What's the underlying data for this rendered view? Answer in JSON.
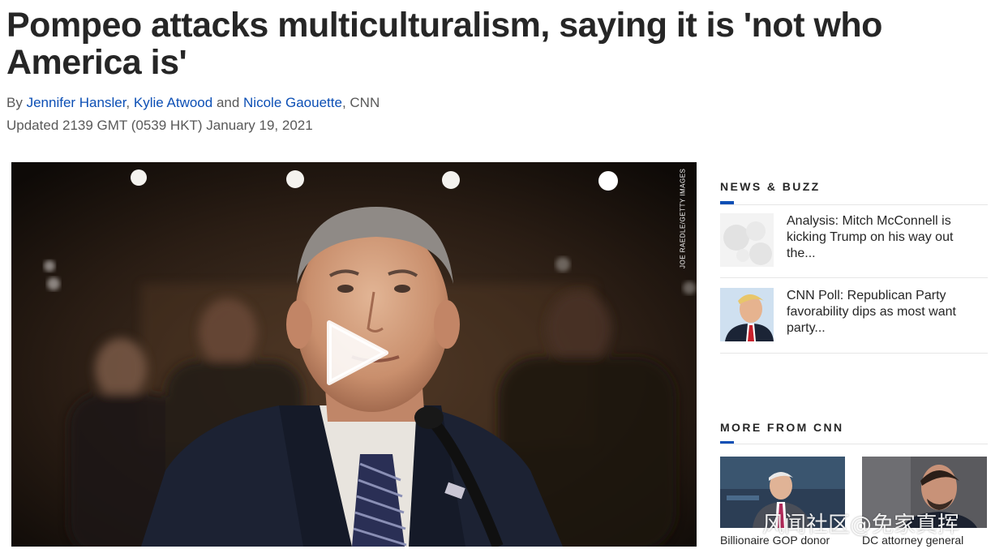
{
  "article": {
    "headline": "Pompeo attacks multiculturalism, saying it is 'not who America is'",
    "byline_prefix": "By",
    "authors": [
      "Jennifer Hansler",
      "Kylie Atwood",
      "Nicole Gaouette"
    ],
    "byline_sep1": ", ",
    "byline_and": " and ",
    "byline_suffix": ", CNN",
    "updated": "Updated 2139 GMT (0539 HKT) January 19, 2021"
  },
  "video": {
    "photo_credit": "JOE RAEDLE/GETTY IMAGES",
    "play_icon": "play-icon"
  },
  "news_buzz": {
    "title": "NEWS & BUZZ",
    "accent": "#0c4fb5",
    "items": [
      {
        "text": "Analysis: Mitch McConnell is kicking Trump on his way out the..."
      },
      {
        "text": "CNN Poll: Republican Party favorability dips as most want party..."
      }
    ]
  },
  "more_from_cnn": {
    "title": "MORE FROM CNN",
    "items": [
      {
        "text": "Billionaire GOP donor"
      },
      {
        "text": "DC attorney general"
      }
    ]
  },
  "watermark": "风闻社区@免家真挥"
}
